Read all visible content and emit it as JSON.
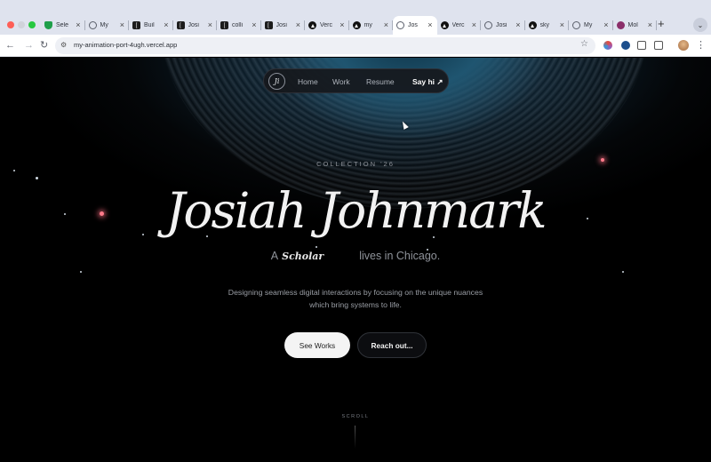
{
  "browser": {
    "tabs": [
      {
        "title": "Sele",
        "icon": "shield-icon",
        "active": false
      },
      {
        "title": "My",
        "icon": "globe-icon",
        "active": false
      },
      {
        "title": "Buil",
        "icon": "bracket-icon",
        "active": false
      },
      {
        "title": "Josi",
        "icon": "bracket-icon",
        "active": false
      },
      {
        "title": "colli",
        "icon": "bracket-icon",
        "active": false
      },
      {
        "title": "Josi",
        "icon": "bracket-icon",
        "active": false
      },
      {
        "title": "Verc",
        "icon": "triangle-icon",
        "active": false
      },
      {
        "title": "my",
        "icon": "triangle-icon",
        "active": false
      },
      {
        "title": "Jos",
        "icon": "globe-icon",
        "active": true
      },
      {
        "title": "Verc",
        "icon": "triangle-icon",
        "active": false
      },
      {
        "title": "Josi",
        "icon": "globe-icon",
        "active": false
      },
      {
        "title": "sky",
        "icon": "triangle-icon",
        "active": false
      },
      {
        "title": "My",
        "icon": "globe-icon",
        "active": false
      },
      {
        "title": "Mol",
        "icon": "mo-icon",
        "active": false
      }
    ],
    "url": "my-animation-port-4ugh.vercel.app"
  },
  "site": {
    "logo": "Ji",
    "nav": {
      "home": "Home",
      "work": "Work",
      "resume": "Resume",
      "say_hi": "Say hi ↗"
    },
    "collection": "COLLECTION '26",
    "name": "Josiah Johnmark",
    "tagline": {
      "prefix": "A",
      "role": "Scholar",
      "suffix": "lives in Chicago."
    },
    "description": "Designing seamless digital interactions by focusing on the unique nuances which bring systems to life.",
    "buttons": {
      "see_works": "See Works",
      "reach_out": "Reach out..."
    },
    "scroll": "SCROLL"
  },
  "colors": {
    "background": "#000000",
    "accent_glow": "#ff7a8a",
    "nav_pill": "#16181c"
  }
}
